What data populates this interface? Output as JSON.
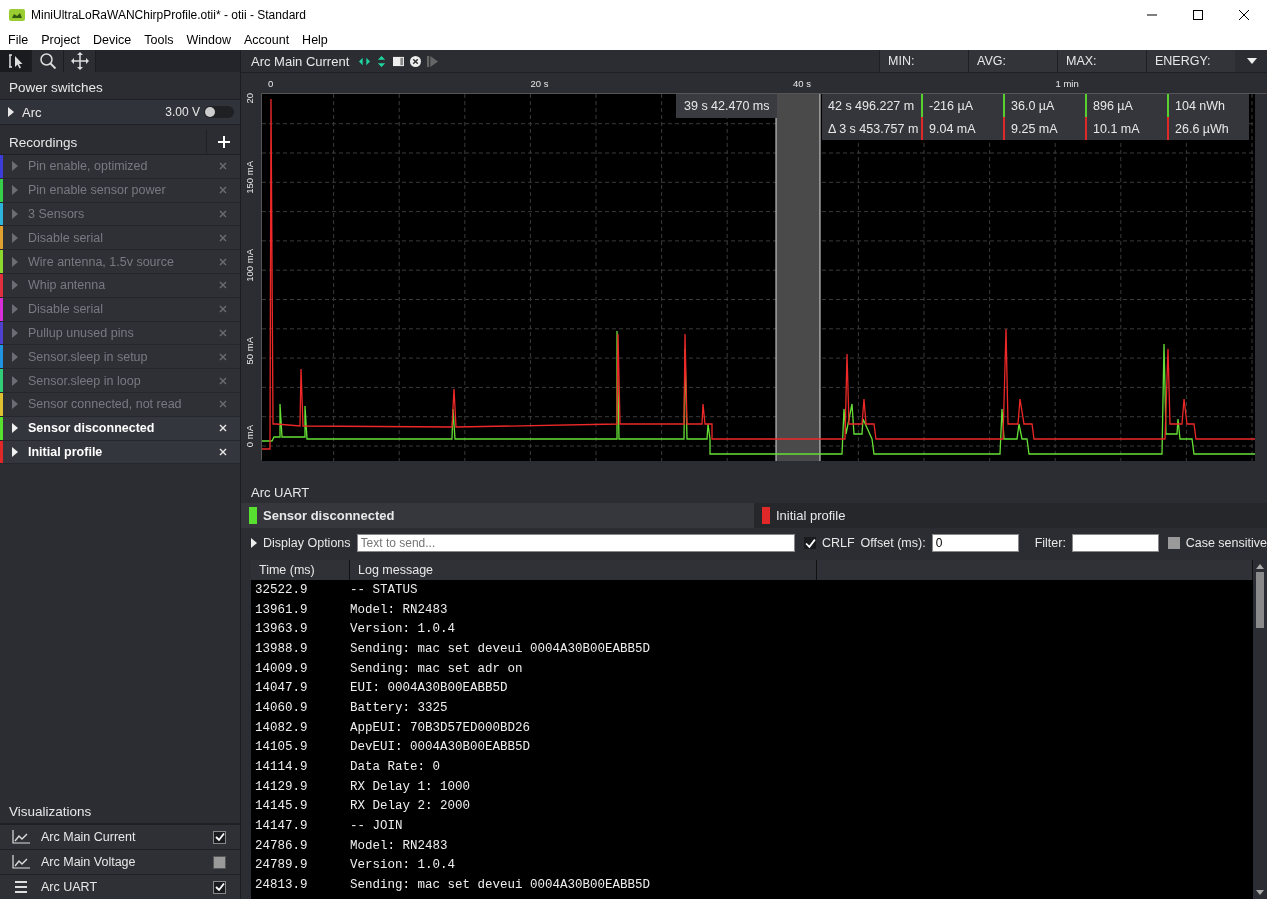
{
  "window": {
    "title": "MiniUltraLoRaWANChirpProfile.otii* - otii - Standard"
  },
  "menu": [
    "File",
    "Project",
    "Device",
    "Tools",
    "Window",
    "Account",
    "Help"
  ],
  "tools": [
    {
      "kind": "select",
      "selected": true
    },
    {
      "kind": "zoom",
      "selected": false
    },
    {
      "kind": "pan",
      "selected": false
    }
  ],
  "power_switches": {
    "title": "Power switches",
    "items": [
      {
        "name": "Arc",
        "voltage": "3.00 V",
        "on": false
      }
    ]
  },
  "recordings": {
    "title": "Recordings",
    "items": [
      {
        "name": "Pin enable, optimized",
        "color": "#3c3cd8",
        "enabled": false
      },
      {
        "name": "Pin enable sensor power",
        "color": "#36cf4a",
        "enabled": false
      },
      {
        "name": "3 Sensors",
        "color": "#2cb4dc",
        "enabled": false
      },
      {
        "name": "Disable serial",
        "color": "#e0a030",
        "enabled": false
      },
      {
        "name": "Wire antenna, 1.5v source",
        "color": "#8cd82c",
        "enabled": false
      },
      {
        "name": "Whip antenna",
        "color": "#e03040",
        "enabled": false
      },
      {
        "name": "Disable serial",
        "color": "#d830d8",
        "enabled": false
      },
      {
        "name": "Pullup unused pins",
        "color": "#5040d0",
        "enabled": false
      },
      {
        "name": "Sensor.sleep in setup",
        "color": "#2094e0",
        "enabled": false
      },
      {
        "name": "Sensor.sleep in loop",
        "color": "#30cc78",
        "enabled": false
      },
      {
        "name": "Sensor connected, not read",
        "color": "#e0c030",
        "enabled": false
      },
      {
        "name": "Sensor disconnected",
        "color": "#58e030",
        "enabled": true
      },
      {
        "name": "Initial profile",
        "color": "#e02828",
        "enabled": true
      }
    ]
  },
  "visualizations": {
    "title": "Visualizations",
    "items": [
      {
        "kind": "graph",
        "name": "Arc Main Current",
        "checked": true
      },
      {
        "kind": "graph",
        "name": "Arc Main Voltage",
        "checked": false
      },
      {
        "kind": "log",
        "name": "Arc UART",
        "checked": true
      }
    ]
  },
  "chart_panel": {
    "title": "Arc Main Current",
    "stats_headers": [
      "MIN:",
      "AVG:",
      "MAX:",
      "ENERGY:"
    ],
    "xticks": [
      "0",
      "20 s",
      "40 s",
      "1 min"
    ],
    "yticks": [
      "20",
      "150 mA",
      "100 mA",
      "50 mA",
      "0 mA"
    ],
    "cursor": "39 s 42.470 ms",
    "stats": [
      {
        "color": "#58d030",
        "time": "42 s 496.227 m",
        "values": [
          "-216 µA",
          "36.0 µA",
          "896 µA",
          "104 nWh"
        ]
      },
      {
        "color": "#e02828",
        "time": "Δ 3 s 453.757 m",
        "values": [
          "9.04 mA",
          "9.25 mA",
          "10.1 mA",
          "26.6 µWh"
        ]
      }
    ]
  },
  "uart": {
    "title": "Arc UART",
    "tabs": [
      {
        "label": "Sensor disconnected",
        "color": "#58e030",
        "selected": true
      },
      {
        "label": "Initial profile",
        "color": "#e02828",
        "selected": false
      }
    ],
    "display_options": "Display Options",
    "send_placeholder": "Text to send...",
    "crlf": {
      "label": "CRLF",
      "checked": true
    },
    "offset": {
      "label": "Offset (ms):",
      "value": "0"
    },
    "filter": {
      "label": "Filter:"
    },
    "case_sensitive": {
      "label": "Case sensitive",
      "checked": false
    },
    "columns": [
      "Time (ms)",
      "Log message"
    ],
    "rows": [
      {
        "time": "32522.9",
        "message": "-- STATUS"
      },
      {
        "time": "13961.9",
        "message": "Model: RN2483"
      },
      {
        "time": "13963.9",
        "message": "Version: 1.0.4"
      },
      {
        "time": "13988.9",
        "message": "Sending: mac set deveui 0004A30B00EABB5D"
      },
      {
        "time": "14009.9",
        "message": "Sending: mac set adr on"
      },
      {
        "time": "14047.9",
        "message": "EUI: 0004A30B00EABB5D"
      },
      {
        "time": "14060.9",
        "message": "Battery: 3325"
      },
      {
        "time": "14082.9",
        "message": "AppEUI: 70B3D57ED000BD26"
      },
      {
        "time": "14105.9",
        "message": "DevEUI: 0004A30B00EABB5D"
      },
      {
        "time": "14114.9",
        "message": "Data Rate: 0"
      },
      {
        "time": "14129.9",
        "message": "RX Delay 1: 1000"
      },
      {
        "time": "14145.9",
        "message": "RX Delay 2: 2000"
      },
      {
        "time": "14147.9",
        "message": "-- JOIN"
      },
      {
        "time": "24786.9",
        "message": "Model: RN2483"
      },
      {
        "time": "24789.9",
        "message": "Version: 1.0.4"
      },
      {
        "time": "24813.9",
        "message": "Sending: mac set deveui 0004A30B00EABB5D"
      }
    ]
  }
}
